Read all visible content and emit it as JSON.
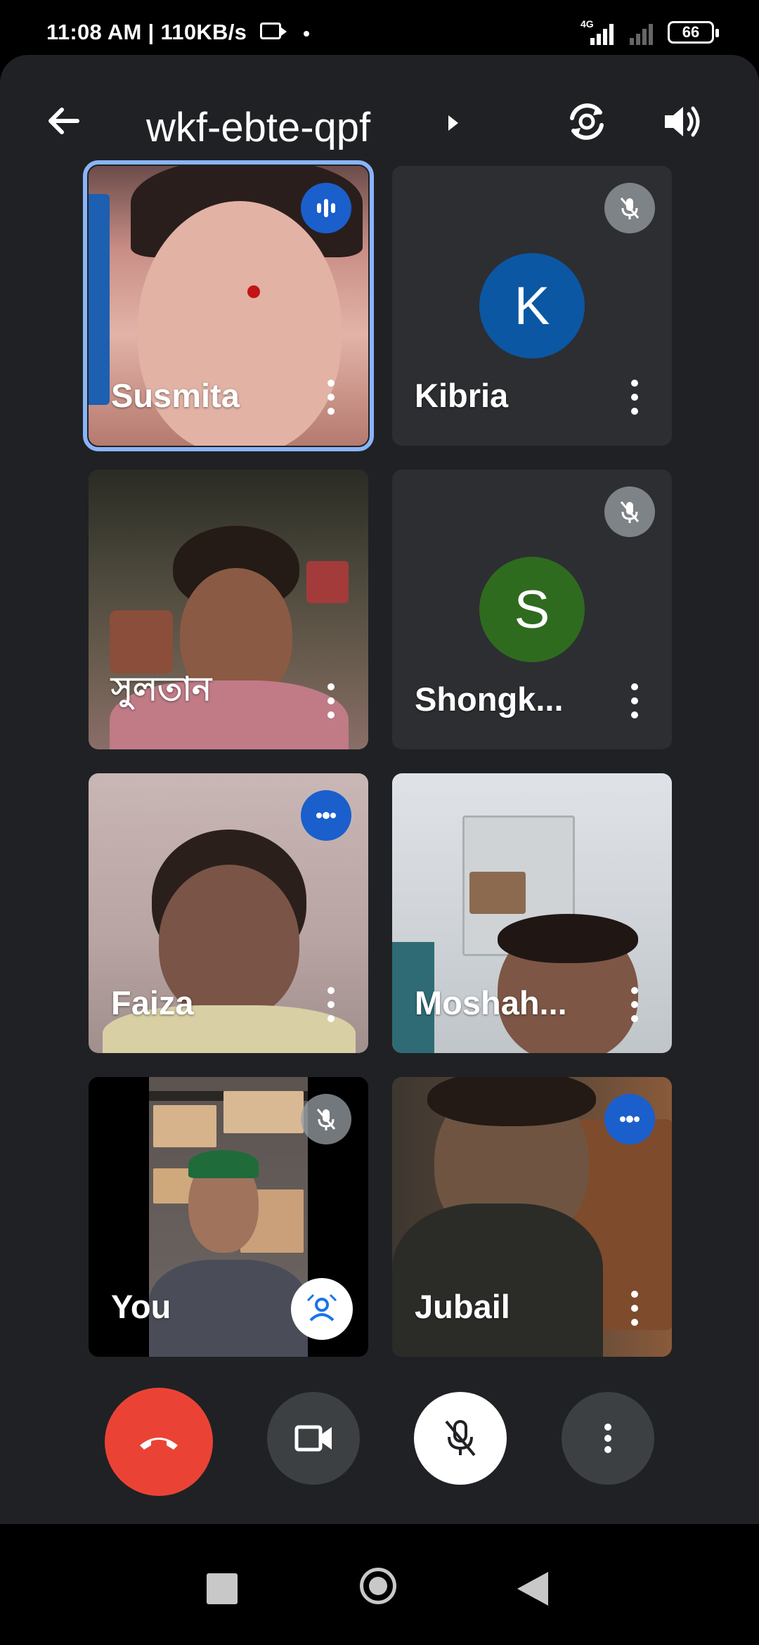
{
  "status_bar": {
    "time_speed": "11:08 AM | 110KB/s",
    "network": "4G",
    "battery": "66"
  },
  "header": {
    "meeting_code": "wkf-ebte-qpf",
    "icons": [
      "back-arrow-icon",
      "chevron-right-icon",
      "switch-camera-icon",
      "speaker-icon"
    ]
  },
  "participants": [
    {
      "name": "Susmita",
      "status": "speaking",
      "badge_color": "#1a5fcc"
    },
    {
      "name": "Kibria",
      "status": "muted",
      "avatar_letter": "K",
      "avatar_color": "#0b57a4"
    },
    {
      "name": "সুলতান",
      "status": "video"
    },
    {
      "name": "Shongk...",
      "status": "muted",
      "avatar_letter": "S",
      "avatar_color": "#2e6b1f"
    },
    {
      "name": "Faiza",
      "status": "audio-dots",
      "badge_color": "#1a5fcc"
    },
    {
      "name": "Moshah...",
      "status": "video"
    },
    {
      "name": "You",
      "status": "muted"
    },
    {
      "name": "Jubail",
      "status": "audio-dots",
      "badge_color": "#1a5fcc"
    }
  ],
  "controls": {
    "end_call_color": "#ea4335",
    "items": [
      "end-call-icon",
      "camera-icon",
      "mic-off-icon",
      "more-vert-icon"
    ]
  },
  "accent": "#8ab4f8"
}
